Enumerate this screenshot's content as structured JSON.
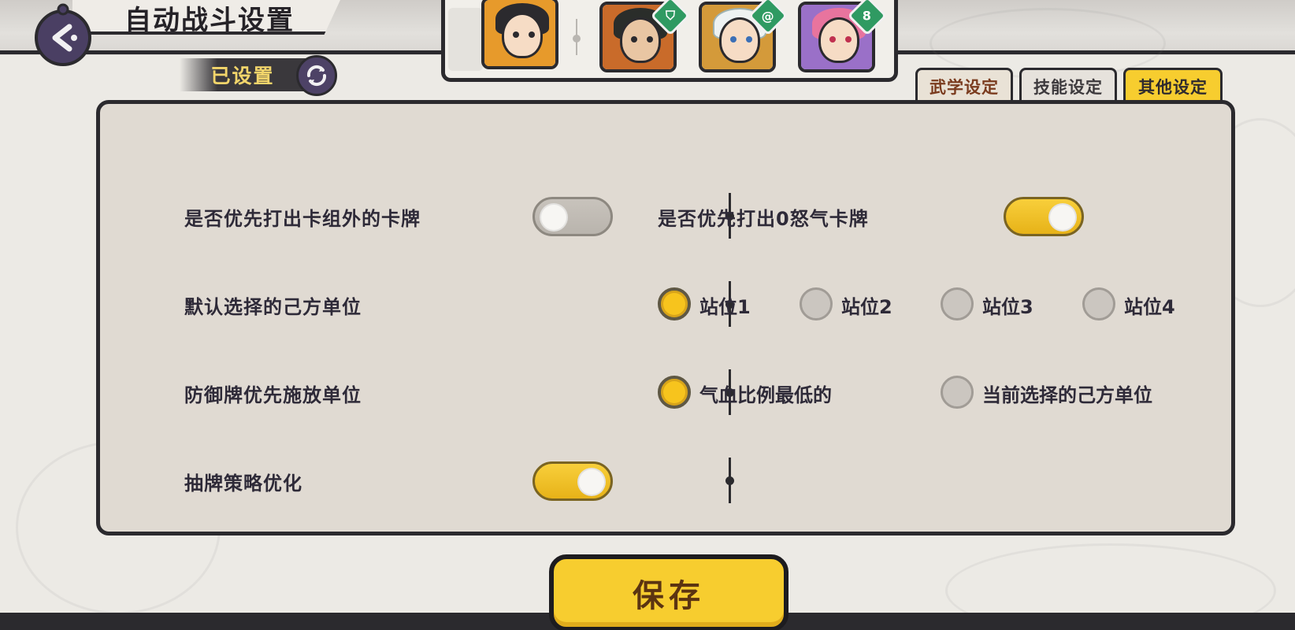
{
  "header": {
    "title": "自动战斗设置",
    "back_icon": "back-arrow-icon"
  },
  "preset": {
    "label": "已设置",
    "refresh_icon": "refresh-icon"
  },
  "team": {
    "members": [
      {
        "name": "portrait-1",
        "role_icon": "",
        "hair": "#2b2a2e",
        "bg": "#e79a2b"
      },
      {
        "name": "portrait-2",
        "role_icon": "shield-icon",
        "hair": "#2a2d2a",
        "bg": "#c96b2a"
      },
      {
        "name": "portrait-3",
        "role_icon": "swirl-icon",
        "hair": "#eef2f2",
        "bg": "#d49a3a"
      },
      {
        "name": "portrait-4",
        "role_icon": "gourd-icon",
        "hair": "#e8749e",
        "bg": "#9a70c8"
      }
    ]
  },
  "tabs": [
    {
      "label": "武学设定",
      "active": false
    },
    {
      "label": "技能设定",
      "active": false
    },
    {
      "label": "其他设定",
      "active": true
    }
  ],
  "settings": {
    "row1_left": {
      "label": "是否优先打出卡组外的卡牌",
      "on": false
    },
    "row1_right": {
      "label": "是否优先打出0怒气卡牌",
      "on": true
    },
    "row2": {
      "label": "默认选择的己方单位",
      "options": [
        "站位1",
        "站位2",
        "站位3",
        "站位4"
      ],
      "selected": "站位1"
    },
    "row3": {
      "label": "防御牌优先施放单位",
      "options": [
        "气血比例最低的",
        "当前选择的己方单位"
      ],
      "selected": "气血比例最低的"
    },
    "row4": {
      "label": "抽牌策略优化",
      "on": true
    }
  },
  "footer": {
    "save_label": "保存"
  },
  "colors": {
    "accent_yellow": "#f7cd2f",
    "panel_bg": "#e0dad2",
    "ink": "#2b2a2e"
  }
}
